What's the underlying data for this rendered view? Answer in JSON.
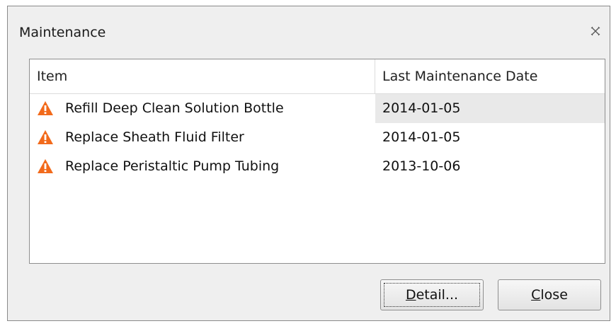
{
  "window": {
    "title": "Maintenance",
    "close_icon": "close-x-icon"
  },
  "table": {
    "columns": [
      "Item",
      "Last Maintenance Date"
    ],
    "rows": [
      {
        "icon": "warning-icon",
        "item": "Refill Deep Clean Solution Bottle",
        "date": "2014-01-05",
        "selected": true
      },
      {
        "icon": "warning-icon",
        "item": "Replace Sheath Fluid Filter",
        "date": "2014-01-05",
        "selected": false
      },
      {
        "icon": "warning-icon",
        "item": "Replace Peristaltic Pump Tubing",
        "date": "2013-10-06",
        "selected": false
      }
    ]
  },
  "buttons": {
    "detail": {
      "mnemonic": "D",
      "rest": "etail..."
    },
    "close": {
      "mnemonic": "C",
      "rest": "lose"
    }
  },
  "colors": {
    "warning": "#f26a1b",
    "selected_row": "#e9e9e9",
    "dialog_bg": "#efefef"
  }
}
